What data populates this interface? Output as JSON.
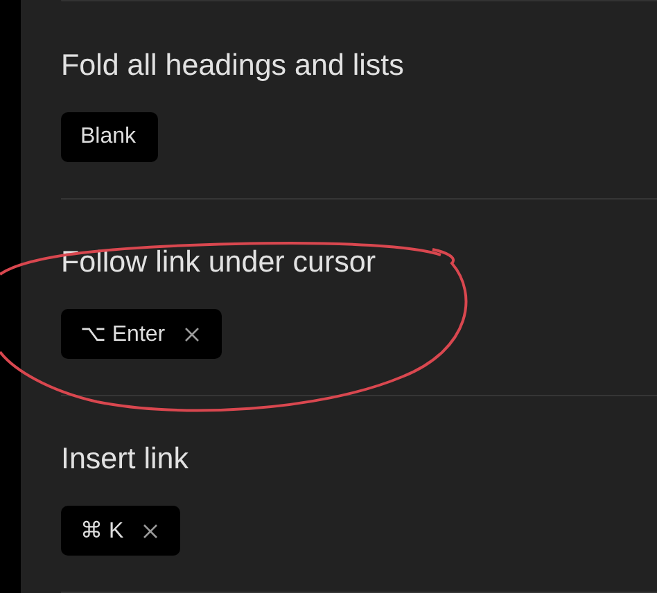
{
  "settings": [
    {
      "title": "Fold all headings and lists",
      "hotkeys": [
        {
          "label": "Blank",
          "removable": false
        }
      ]
    },
    {
      "title": "Follow link under cursor",
      "hotkeys": [
        {
          "label": "⌥ Enter",
          "removable": true
        }
      ]
    },
    {
      "title": "Insert link",
      "hotkeys": [
        {
          "label": "⌘ K",
          "removable": true
        }
      ]
    }
  ]
}
